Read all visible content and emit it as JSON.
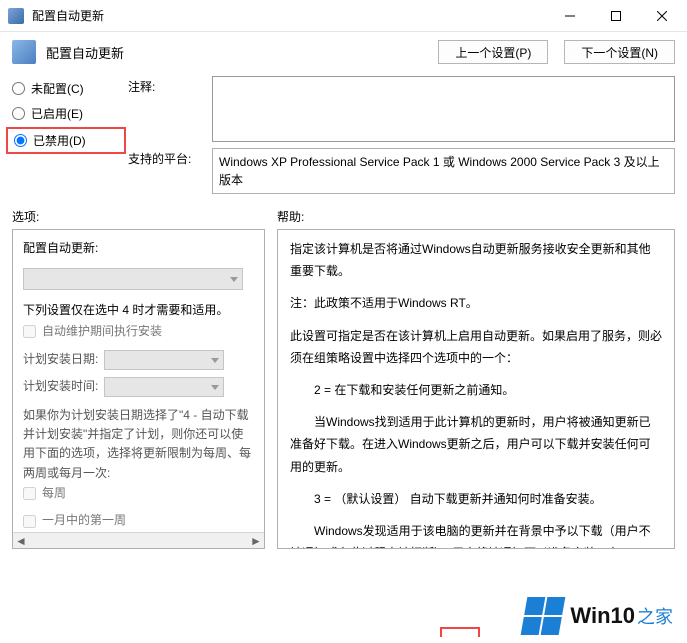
{
  "window": {
    "title": "配置自动更新",
    "minimize": "—",
    "maximize": "□",
    "close": "×"
  },
  "header": {
    "page_title": "配置自动更新",
    "prev_setting": "上一个设置(P)",
    "next_setting": "下一个设置(N)"
  },
  "radios": {
    "not_configured": "未配置(C)",
    "enabled": "已启用(E)",
    "disabled": "已禁用(D)",
    "selected": "disabled"
  },
  "fields": {
    "comment_label": "注释:",
    "platform_label": "支持的平台:",
    "platform_text": "Windows XP Professional Service Pack 1 或 Windows 2000 Service Pack 3 及以上版本"
  },
  "panels": {
    "options_label": "选项:",
    "help_label": "帮助:"
  },
  "options": {
    "title": "配置自动更新:",
    "note": "下列设置仅在选中 4 时才需要和适用。",
    "cb_maint": "自动维护期间执行安装",
    "sched_date_label": "计划安装日期:",
    "sched_time_label": "计划安装时间:",
    "paragraph": "如果你为计划安装日期选择了\"4 - 自动下载并计划安装\"并指定了计划，则你还可以使用下面的选项，选择将更新限制为每周、每两周或每月一次:",
    "cb_weekly": "每周",
    "cb_month_first": "一月中的第一周"
  },
  "help": {
    "p1": "指定该计算机是否将通过Windows自动更新服务接收安全更新和其他重要下载。",
    "p2": "注：此政策不适用于Windows RT。",
    "p3": "此设置可指定是否在该计算机上启用自动更新。如果启用了服务，则必须在组策略设置中选择四个选项中的一个：",
    "p4": "2 = 在下载和安装任何更新之前通知。",
    "p5": "当Windows找到适用于此计算机的更新时，用户将被通知更新已准备好下载。在进入Windows更新之后，用户可以下载并安装任何可用的更新。",
    "p6": "3 = （默认设置） 自动下载更新并通知何时准备安装。",
    "p7": "Windows发现适用于该电脑的更新并在背景中予以下载（用户不被通知或在此过程中被打断）。用户将被通知可以准备安装。在Windows更新后，用户可"
  },
  "watermark": {
    "brand": "Win10",
    "suffix": "之家"
  }
}
